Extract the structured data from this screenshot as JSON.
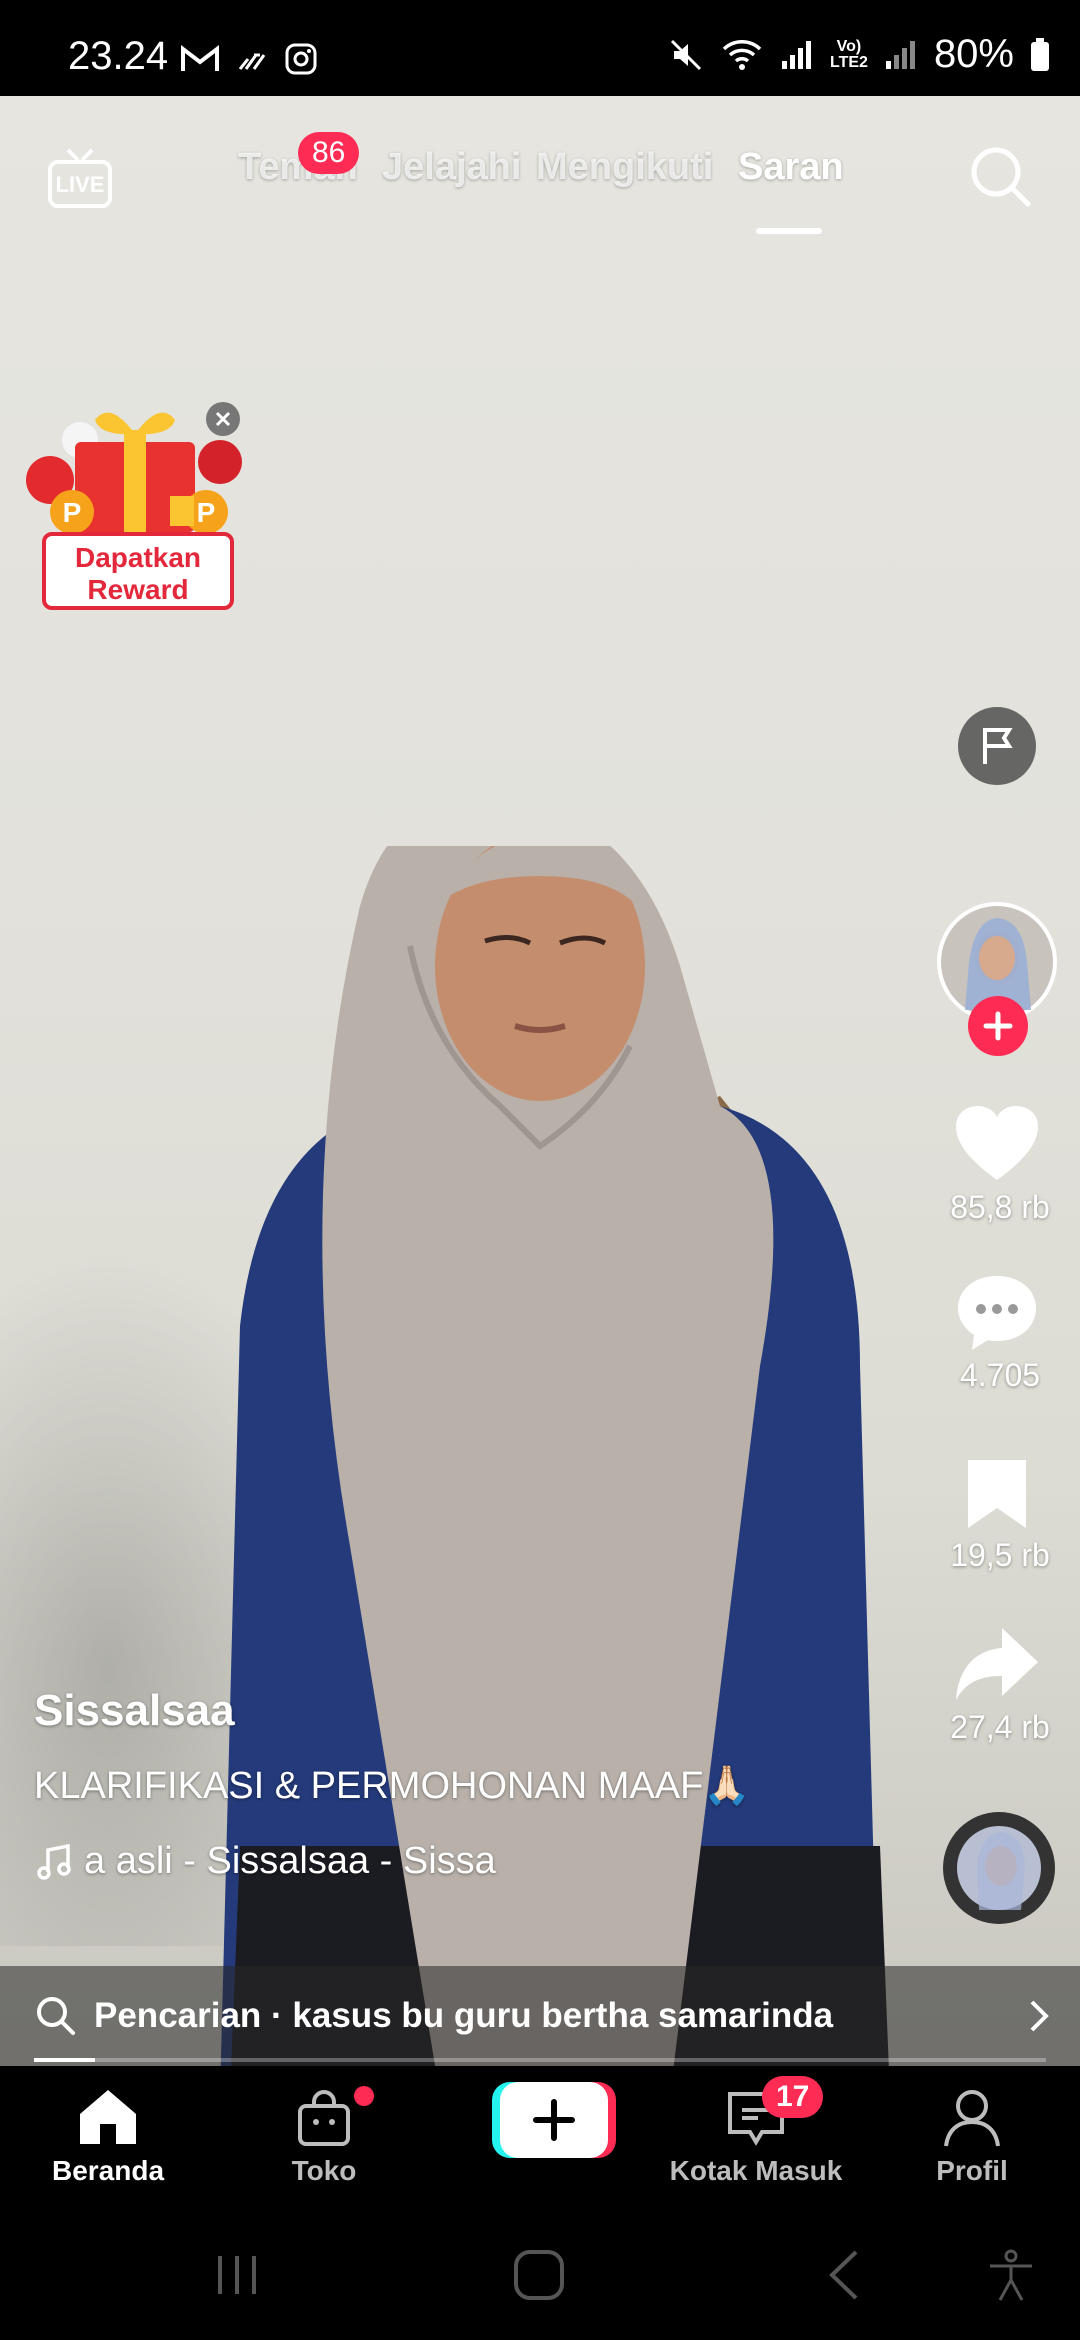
{
  "status": {
    "time": "23.24",
    "battery": "80%",
    "network": "LTE2",
    "network_top": "Vo)"
  },
  "top_nav": {
    "tabs": [
      {
        "label": "Teman",
        "badge": "86"
      },
      {
        "label": "Jelajahi"
      },
      {
        "label": "Mengikuti"
      },
      {
        "label": "Saran",
        "active": true
      }
    ]
  },
  "reward": {
    "line1": "Dapatkan",
    "line2": "Reward"
  },
  "actions": {
    "likes": "85,8 rb",
    "comments": "4.705",
    "saves": "19,5 rb",
    "shares": "27,4 rb"
  },
  "post": {
    "username": "Sissalsaa",
    "description": "KLARIFIKASI & PERMOHONAN MAAF🙏🏻",
    "music": "a asli - Sissalsaa - Sissa",
    "progress_fraction": 0.06
  },
  "search": {
    "label": "Pencarian · kasus bu guru bertha samarinda"
  },
  "bottom_nav": {
    "items": [
      {
        "label": "Beranda",
        "icon": "home-icon",
        "active": true
      },
      {
        "label": "Toko",
        "icon": "shop-bag-icon"
      },
      {
        "label": "",
        "icon": "create-plus-icon"
      },
      {
        "label": "Kotak Masuk",
        "icon": "inbox-icon",
        "badge": "17"
      },
      {
        "label": "Profil",
        "icon": "profile-icon"
      }
    ]
  },
  "colors": {
    "accent": "#fe2c55",
    "cyan": "#25f4ee"
  }
}
